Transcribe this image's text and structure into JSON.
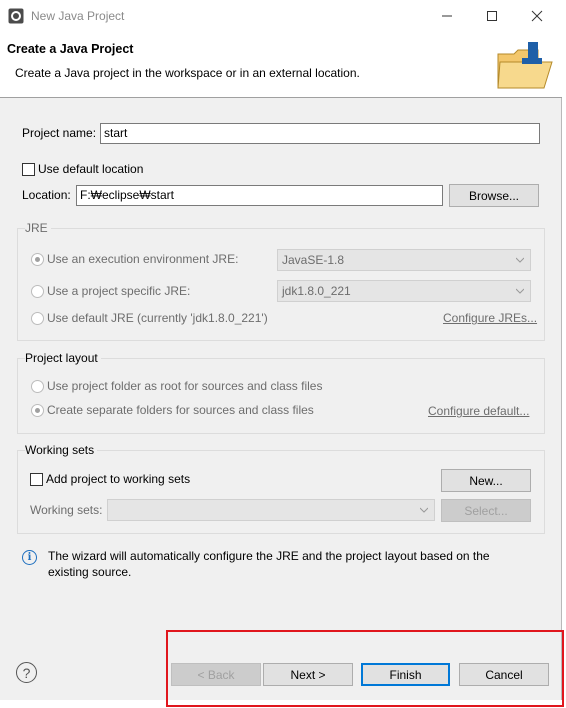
{
  "window": {
    "title": "New Java Project",
    "minimize_icon": "minimize-icon",
    "maximize_icon": "maximize-icon",
    "close_icon": "close-icon"
  },
  "banner": {
    "title": "Create a Java Project",
    "description": "Create a Java project in the workspace or in an external location.",
    "image_icon": "java-project-folder-icon"
  },
  "project": {
    "name_label": "Project name:",
    "name_value": "start",
    "use_default_location_label": "Use default location",
    "use_default_location_checked": false,
    "location_label": "Location:",
    "location_value": "F:₩eclipse₩start",
    "browse_label": "Browse..."
  },
  "jre": {
    "group_title": "JRE",
    "options": [
      {
        "label": "Use an execution environment JRE:",
        "selected": true
      },
      {
        "label": "Use a project specific JRE:",
        "selected": false
      },
      {
        "label": "Use default JRE (currently 'jdk1.8.0_221')",
        "selected": false
      }
    ],
    "exec_env_value": "JavaSE-1.8",
    "project_jre_value": "jdk1.8.0_221",
    "configure_link": "Configure JREs..."
  },
  "layout": {
    "group_title": "Project layout",
    "options": [
      {
        "label": "Use project folder as root for sources and class files",
        "selected": false
      },
      {
        "label": "Create separate folders for sources and class files",
        "selected": true
      }
    ],
    "configure_link": "Configure default..."
  },
  "working_sets": {
    "group_title": "Working sets",
    "add_label": "Add project to working sets",
    "add_checked": false,
    "new_label": "New...",
    "sets_label": "Working sets:",
    "select_label": "Select..."
  },
  "info": {
    "icon": "info-icon",
    "message_line1": "The wizard will automatically configure the JRE and the project layout based on the",
    "message_line2": "existing source."
  },
  "footer": {
    "help_icon": "help-icon",
    "back_label": "< Back",
    "next_label": "Next >",
    "finish_label": "Finish",
    "cancel_label": "Cancel"
  },
  "colors": {
    "highlight": "#e0161d",
    "accent": "#0078d7",
    "dialog_background": "#f0f0f0"
  }
}
